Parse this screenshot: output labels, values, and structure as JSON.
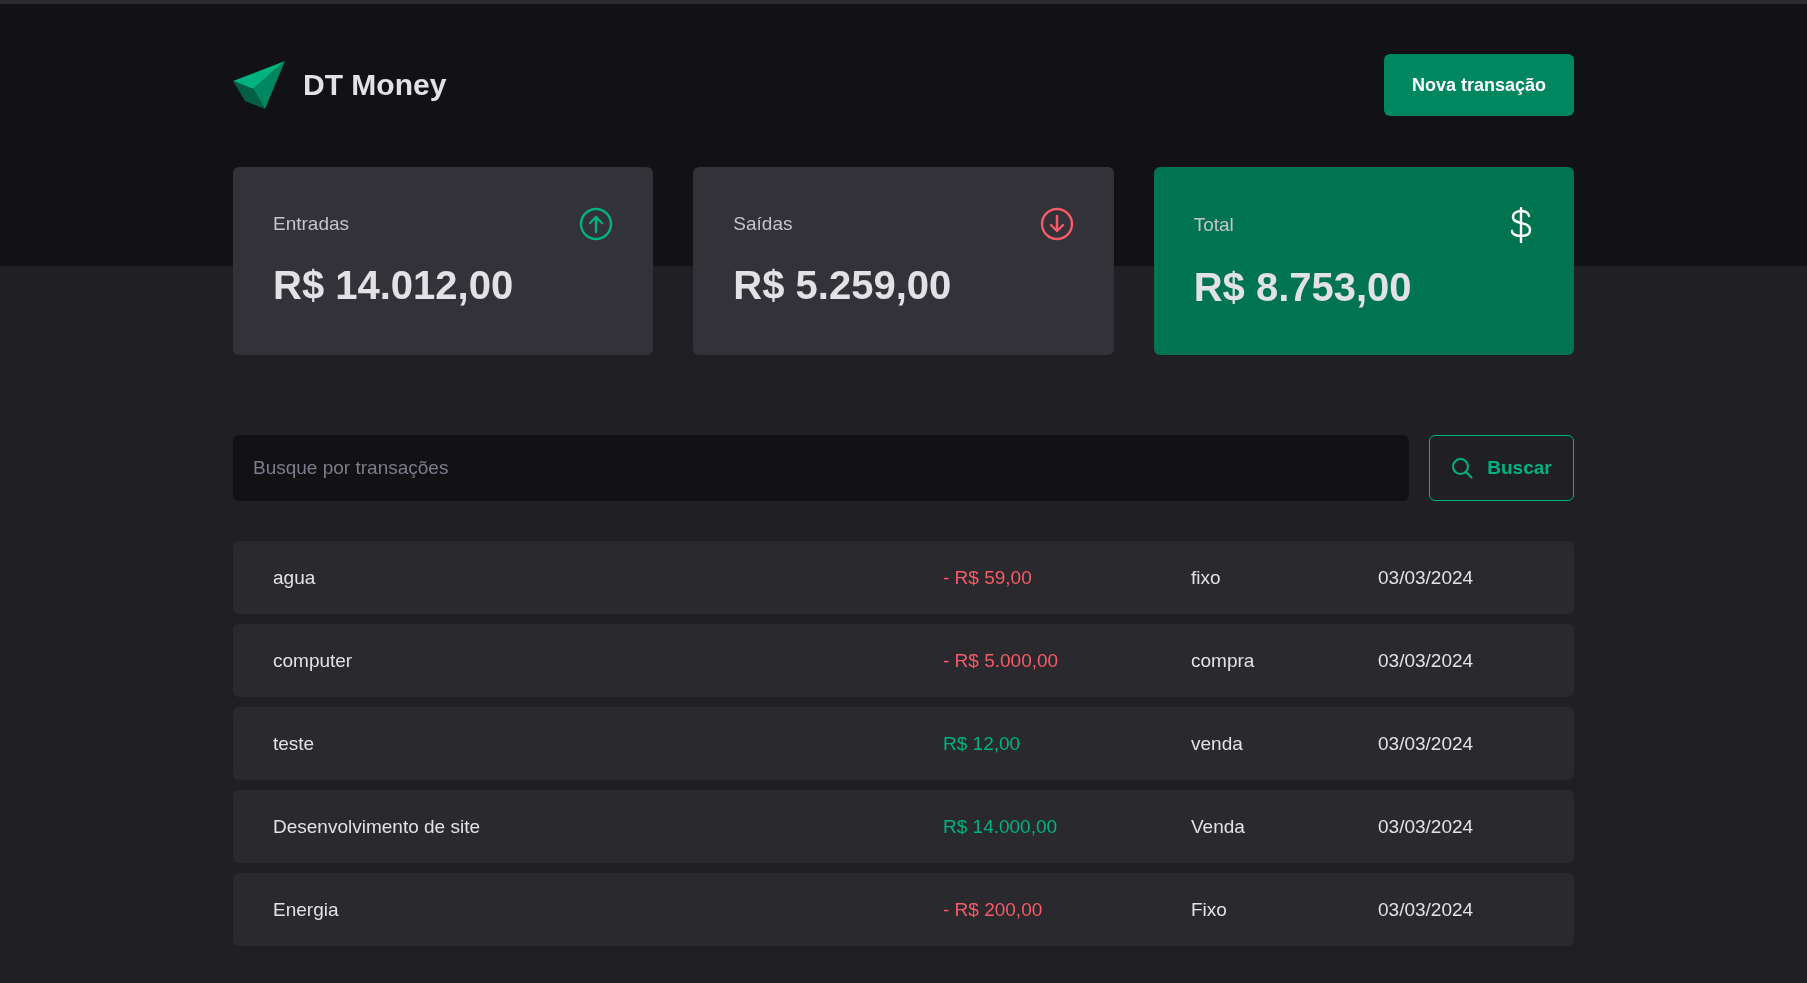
{
  "header": {
    "app_name": "DT Money",
    "new_button": "Nova transação"
  },
  "summary": [
    {
      "kind": "income",
      "label": "Entradas",
      "value": "R$ 14.012,00"
    },
    {
      "kind": "outcome",
      "label": "Saídas",
      "value": "R$ 5.259,00"
    },
    {
      "kind": "total",
      "label": "Total",
      "value": "R$ 8.753,00"
    }
  ],
  "search": {
    "placeholder": "Busque por transações",
    "button": "Buscar"
  },
  "transactions": [
    {
      "description": "agua",
      "kind": "outcome",
      "price": "- R$ 59,00",
      "category": "fixo",
      "date": "03/03/2024"
    },
    {
      "description": "computer",
      "kind": "outcome",
      "price": "- R$ 5.000,00",
      "category": "compra",
      "date": "03/03/2024"
    },
    {
      "description": "teste",
      "kind": "income",
      "price": "R$ 12,00",
      "category": "venda",
      "date": "03/03/2024"
    },
    {
      "description": "Desenvolvimento de site",
      "kind": "income",
      "price": "R$ 14.000,00",
      "category": "Venda",
      "date": "03/03/2024"
    },
    {
      "description": "Energia",
      "kind": "outcome",
      "price": "- R$ 200,00",
      "category": "Fixo",
      "date": "03/03/2024"
    }
  ]
}
